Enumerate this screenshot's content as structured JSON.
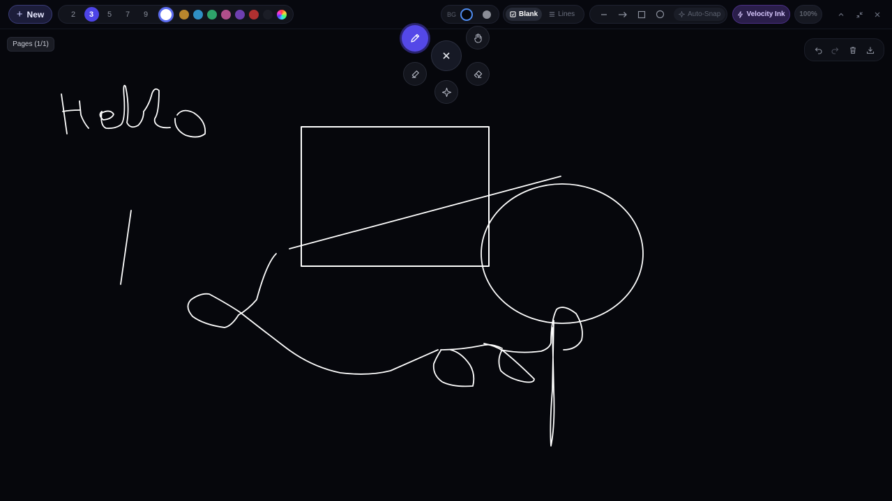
{
  "toolbar": {
    "new_label": "New",
    "sizes": [
      "2",
      "3",
      "5",
      "7",
      "9"
    ],
    "active_size": "3",
    "colors": [
      "#ffffff",
      "#b8862d",
      "#2f8fc4",
      "#2ea36a",
      "#b04f8a",
      "#6e3fb0",
      "#b03030",
      "#1b1d26"
    ],
    "selected_color": "#ffffff",
    "bg_label": "BG",
    "blank_label": "Blank",
    "lines_label": "Lines",
    "autosnap_label": "Auto-Snap",
    "velocity_label": "Velocity Ink",
    "zoom_label": "100%"
  },
  "pages_label": "Pages (1/1)",
  "icons": {
    "pen": "pencil-icon",
    "hand": "hand-icon",
    "close": "close-icon",
    "highlighter": "highlighter-icon",
    "eraser": "eraser-icon",
    "magic": "sparkle-icon"
  },
  "canvas": {
    "background": "#06070c",
    "stroke_color": "#ffffff",
    "text": "Hello"
  }
}
